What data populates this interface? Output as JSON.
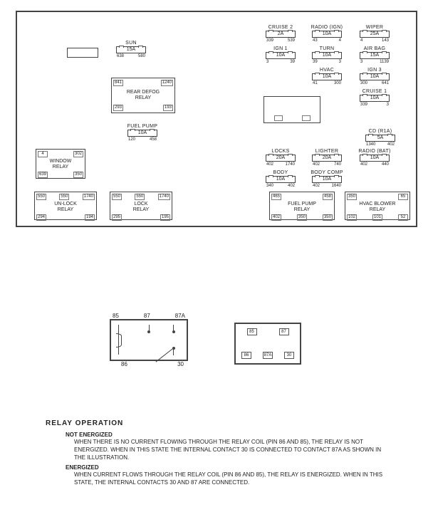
{
  "fuses": {
    "sun": {
      "label": "SUN",
      "amp": "15A",
      "p1": "638",
      "p2": "580"
    },
    "cruise2": {
      "label": "CRUISE 2",
      "amp": "2A",
      "p1": "339",
      "p2": "539"
    },
    "radio_ign": {
      "label": "RADIO (IGN)",
      "amp": "10A",
      "p1": "43",
      "p2": "4"
    },
    "wiper": {
      "label": "WIPER",
      "amp": "25A",
      "p1": "4",
      "p2": "143"
    },
    "ign1": {
      "label": "IGN 1",
      "amp": "10A",
      "p1": "3",
      "p2": "39"
    },
    "turn": {
      "label": "TURN",
      "amp": "10A",
      "p1": "39",
      "p2": "3"
    },
    "airbag": {
      "label": "AIR BAG",
      "amp": "15A",
      "p1": "3",
      "p2": "1139"
    },
    "hvac": {
      "label": "HVAC",
      "amp": "10A",
      "p1": "41",
      "p2": "300"
    },
    "ign3": {
      "label": "IGN 3",
      "amp": "10A",
      "p1": "300",
      "p2": "641"
    },
    "cruise1": {
      "label": "CRUISE 1",
      "amp": "10A",
      "p1": "339",
      "p2": "3"
    },
    "fuelpump": {
      "label": "FUEL PUMP",
      "amp": "10A",
      "p1": "120",
      "p2": "458"
    },
    "cd_r1a": {
      "label": "CD (R1A)",
      "amp": "5A",
      "p1": "1340",
      "p2": "402"
    },
    "locks": {
      "label": "LOCKS",
      "amp": "20A",
      "p1": "402",
      "p2": "1740"
    },
    "lighter": {
      "label": "LIGHTER",
      "amp": "20A",
      "p1": "402",
      "p2": "740"
    },
    "radio_bat": {
      "label": "RADIO (BAT)",
      "amp": "10A",
      "p1": "402",
      "p2": "440"
    },
    "body": {
      "label": "BODY",
      "amp": "10A",
      "p1": "340",
      "p2": "402"
    },
    "body_comp": {
      "label": "BODY COMP",
      "amp": "10A",
      "p1": "402",
      "p2": "1640"
    }
  },
  "relays": {
    "rear_defog": {
      "name": "REAR DEFOG\nRELAY",
      "tl": "841",
      "tr": "1240",
      "bl": "293",
      "br": "193"
    },
    "window": {
      "name": "WINDOW\nRELAY",
      "tl": "4",
      "tr": "302",
      "bl": "639",
      "br": "350"
    },
    "unlock": {
      "name": "UN-LOCK\nRELAY",
      "tl": "550",
      "tc": "550",
      "tr": "1740",
      "bl": "294",
      "br": "194"
    },
    "lock": {
      "name": "LOCK\nRELAY",
      "tl": "550",
      "tc": "550",
      "tr": "1740",
      "bl": "295",
      "br": "195"
    },
    "fuelpump": {
      "name": "FUEL PUMP\nRELAY",
      "tl": "465",
      "tr": "458",
      "bl": "402",
      "bc": "350",
      "br": "350"
    },
    "hvac": {
      "name": "HVAC BLOWER\nRELAY",
      "tl": "350",
      "tr": "65",
      "bl": "102",
      "bc": "101",
      "br": "52"
    }
  },
  "schematic": {
    "top": {
      "p85": "85",
      "p87": "87",
      "p87a": "87A"
    },
    "bot": {
      "p86": "86",
      "p30": "30"
    }
  },
  "socket": {
    "r1": [
      "85",
      "87"
    ],
    "r2": [
      "86",
      "87A",
      "30"
    ]
  },
  "operation": {
    "title": "RELAY OPERATION",
    "ne_title": "NOT ENERGIZED",
    "ne_body": "WHEN THERE IS NO CURRENT FLOWING THROUGH THE RELAY COIL (PIN 86 AND 85), THE RELAY IS NOT ENERGIZED. WHEN IN THIS STATE THE INTERNAL CONTACT 30 IS CONNECTED TO CONTACT 87A AS SHOWN IN THE ILLUSTRATION.",
    "en_title": "ENERGIZED",
    "en_body": "WHEN CURRENT FLOWS THROUGH THE RELAY COIL (PIN 86 AND 85), THE RELAY IS ENERGIZED. WHEN IN THIS STATE, THE INTERNAL CONTACTS 30 AND 87 ARE CONNECTED."
  }
}
